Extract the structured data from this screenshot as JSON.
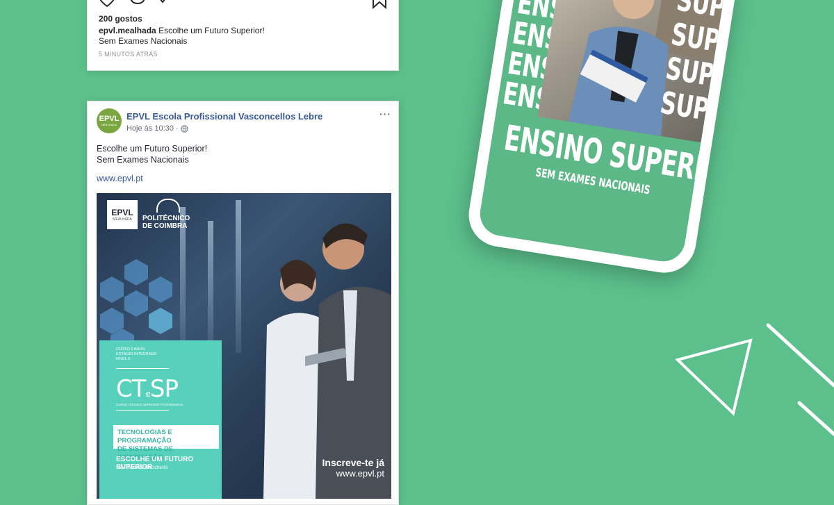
{
  "instagram": {
    "likes": "200 gostos",
    "username": "epvl.mealhada",
    "caption_line1": "Escolhe um Futuro Superior!",
    "caption_line2": "Sem Exames Nacionais",
    "time": "5 MINUTOS ATRÁS"
  },
  "facebook": {
    "avatar_line1": "EPVL",
    "avatar_line2": "MEALHADA",
    "page_name": "EPVL Escola Profissional Vasconcellos Lebre",
    "timestamp": "Hoje às 10:30 ·",
    "more": "···",
    "text_line1": "Escolhe um Futuro Superior!",
    "text_line2": "Sem Exames Nacionais",
    "link": "www.epvl.pt",
    "ad": {
      "logo_epvl": "EPVL",
      "logo_epvl_sub": "MEALHADA",
      "logo_ipc_line1": "POLITÉCNICO",
      "logo_ipc_line2": "DE COIMBRA",
      "panel_small1": "CURSO 2 ANOS",
      "panel_small2": "ESTÁGIO INTEGRADO",
      "panel_small3": "NÍVEL 5",
      "ctesp_a": "CT",
      "ctesp_b": "e",
      "ctesp_c": "SP",
      "ctesp_sub": "CURSO TÉCNICO SUPERIOR PROFISSIONAL",
      "course_line1": "TECNOLOGIAS E PROGRAMAÇÃO",
      "course_line2": "DE SISTEMAS DE INFORMAÇÃO",
      "cta": "ESCOLHE UM FUTURO SUPERIOR",
      "cta_sub": "SEM EXAMES NACIONAIS",
      "signup": "Inscreve-te já",
      "site": "www.epvl.pt"
    }
  },
  "phone": {
    "repeat_word": "ENSINO",
    "repeat_word2": "SUPERIOR",
    "headline": "ENSINO SUPERIOR",
    "subline": "SEM EXAMES NACIONAIS"
  },
  "colors": {
    "background": "#5cc08c",
    "fb_link": "#385898",
    "teal_panel": "#57d1bc"
  }
}
